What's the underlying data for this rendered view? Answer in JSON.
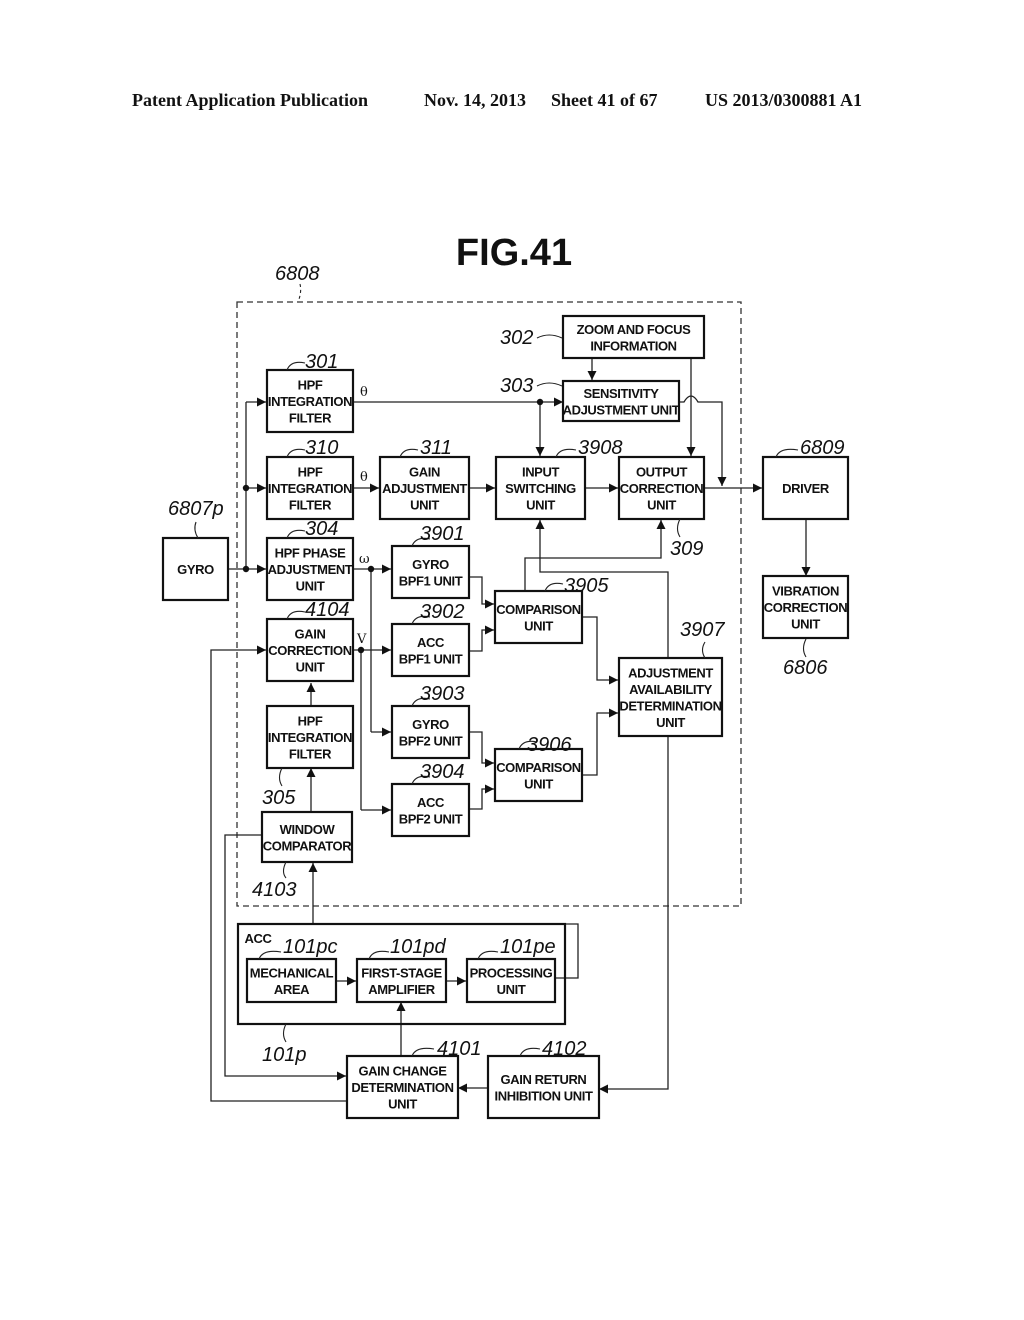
{
  "header": {
    "publication": "Patent Application Publication",
    "date": "Nov. 14, 2013",
    "sheet": "Sheet 41 of 67",
    "number": "US 2013/0300881 A1"
  },
  "figure": {
    "title": "FIG.41"
  },
  "refs": {
    "r6808": "6808",
    "r6807p": "6807p",
    "r301": "301",
    "r310": "310",
    "r304": "304",
    "r4104": "4104",
    "r305": "305",
    "r4103": "4103",
    "r311": "311",
    "r302": "302",
    "r303": "303",
    "r3908": "3908",
    "r309": "309",
    "r3901": "3901",
    "r3902": "3902",
    "r3903": "3903",
    "r3904": "3904",
    "r3905": "3905",
    "r3906": "3906",
    "r3907": "3907",
    "r6809": "6809",
    "r6806": "6806",
    "r101pc": "101pc",
    "r101pd": "101pd",
    "r101pe": "101pe",
    "r101p": "101p",
    "r4101": "4101",
    "r4102": "4102"
  },
  "signals": {
    "theta1": "θ",
    "theta2": "θ",
    "omega": "ω",
    "v": "V"
  },
  "blocks": {
    "gyro": [
      "GYRO"
    ],
    "hpf301": [
      "HPF",
      "INTEGRATION",
      "FILTER"
    ],
    "hpf310": [
      "HPF",
      "INTEGRATION",
      "FILTER"
    ],
    "hpf304": [
      "HPF PHASE",
      "ADJUSTMENT",
      "UNIT"
    ],
    "gain4104": [
      "GAIN",
      "CORRECTION",
      "UNIT"
    ],
    "hpf305": [
      "HPF",
      "INTEGRATION",
      "FILTER"
    ],
    "window4103": [
      "WINDOW",
      "COMPARATOR"
    ],
    "gain311": [
      "GAIN",
      "ADJUSTMENT",
      "UNIT"
    ],
    "zoom302": [
      "ZOOM AND FOCUS",
      "INFORMATION"
    ],
    "sens303": [
      "SENSITIVITY",
      "ADJUSTMENT UNIT"
    ],
    "input3908": [
      "INPUT",
      "SWITCHING",
      "UNIT"
    ],
    "output309": [
      "OUTPUT",
      "CORRECTION",
      "UNIT"
    ],
    "gyrobpf1": [
      "GYRO",
      "BPF1 UNIT"
    ],
    "accbpf1": [
      "ACC",
      "BPF1 UNIT"
    ],
    "gyrobpf2": [
      "GYRO",
      "BPF2 UNIT"
    ],
    "accbpf2": [
      "ACC",
      "BPF2 UNIT"
    ],
    "comp3905": [
      "COMPARISON",
      "UNIT"
    ],
    "comp3906": [
      "COMPARISON",
      "UNIT"
    ],
    "adj3907": [
      "ADJUSTMENT",
      "AVAILABILITY",
      "DETERMINATION",
      "UNIT"
    ],
    "driver": [
      "DRIVER"
    ],
    "vib6806": [
      "VIBRATION",
      "CORRECTION",
      "UNIT"
    ],
    "acc_label": [
      "ACC"
    ],
    "mech": [
      "MECHANICAL",
      "AREA"
    ],
    "amp": [
      "FIRST-STAGE",
      "AMPLIFIER"
    ],
    "proc": [
      "PROCESSING",
      "UNIT"
    ],
    "gcd4101": [
      "GAIN CHANGE",
      "DETERMINATION",
      "UNIT"
    ],
    "gri4102": [
      "GAIN RETURN",
      "INHIBITION UNIT"
    ]
  }
}
